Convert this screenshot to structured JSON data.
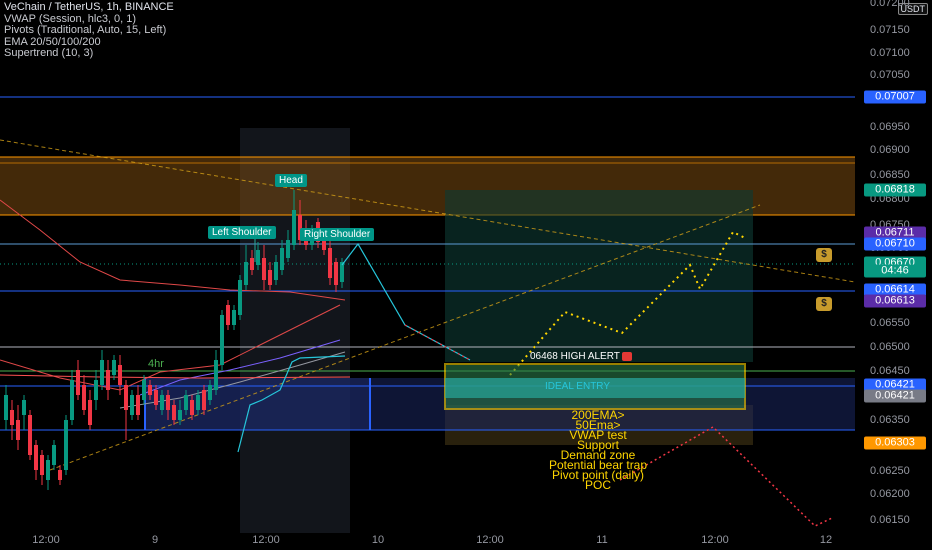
{
  "legend": {
    "title": "VeChain / TetherUS, 1h, BINANCE",
    "lines": [
      "VWAP (Session, hlc3, 0, 1)",
      "Pivots (Traditional, Auto, 15, Left)",
      "EMA 20/50/100/200",
      "Supertrend (10, 3)"
    ]
  },
  "currency": "USDT",
  "price_axis": {
    "ticks": [
      "0.07200",
      "0.07150",
      "0.07100",
      "0.07050",
      "0.07000",
      "0.06950",
      "0.06900",
      "0.06850",
      "0.06800",
      "0.06750",
      "0.06700",
      "0.06650",
      "0.06600",
      "0.06550",
      "0.06500",
      "0.06450",
      "0.06400",
      "0.06350",
      "0.06300",
      "0.06250",
      "0.06200",
      "0.06150"
    ],
    "badges": [
      {
        "text": "0.07007",
        "color": "#2962ff"
      },
      {
        "text": "0.06818",
        "color": "#089981"
      },
      {
        "text": "0.06711",
        "color": "#5b2ca8"
      },
      {
        "text": "0.06710",
        "color": "#2962ff"
      },
      {
        "text": "0.06670",
        "color": "#089981"
      },
      {
        "text": "04:46",
        "color": "#089981"
      },
      {
        "text": "0.06614",
        "color": "#2962ff"
      },
      {
        "text": "0.06613",
        "color": "#5b2ca8"
      },
      {
        "text": "0.06421",
        "color": "#2962ff"
      },
      {
        "text": "0.06421",
        "color": "#787b86"
      },
      {
        "text": "0.06303",
        "color": "#ff9800"
      }
    ]
  },
  "time_axis": [
    "12:00",
    "9",
    "12:00",
    "10",
    "12:00",
    "11",
    "12:00",
    "12"
  ],
  "pattern_labels": {
    "head": "Head",
    "left_shoulder": "Left Shoulder",
    "right_shoulder": "Right Shoulder"
  },
  "timeframe_label": "4hr",
  "alert": "06468 HIGH ALERT",
  "box_label": "IDEAL ENTRY",
  "notes": [
    "200EMA>",
    "50Ema>",
    "VWAP test",
    "Support",
    "Demand zone",
    "Potential bear trap",
    "Pivot point (daily)",
    "POC"
  ],
  "colors": {
    "up": "#089981",
    "down": "#f23645",
    "accent": "#ffd600"
  }
}
